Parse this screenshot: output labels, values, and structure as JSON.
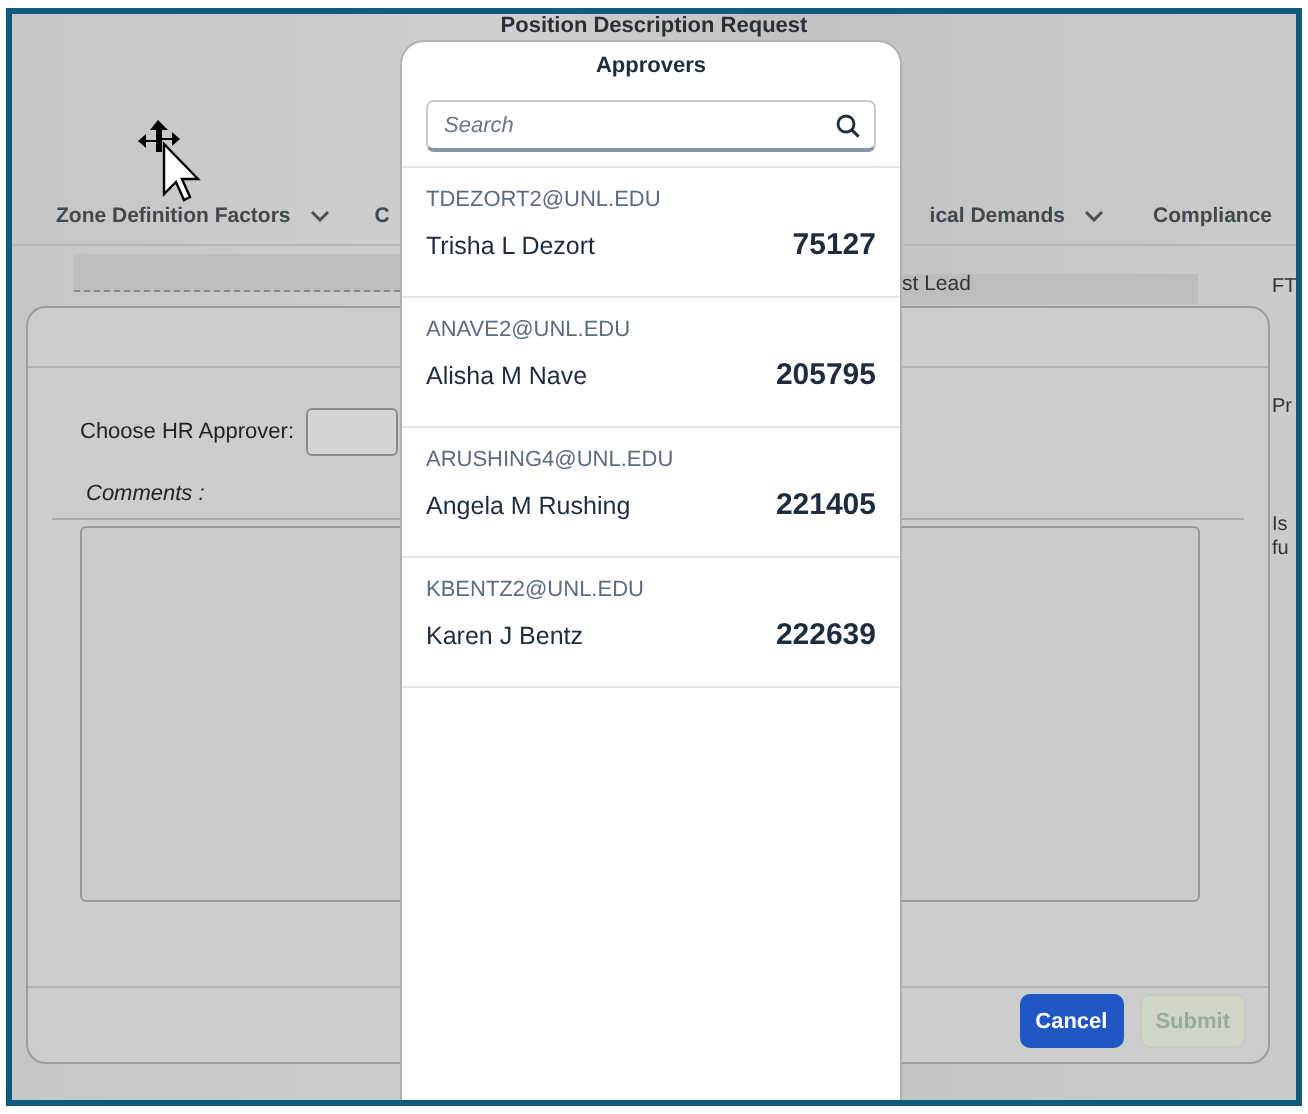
{
  "page": {
    "title": "Position Description Request",
    "tabs": [
      {
        "label": "Zone Definition Factors",
        "dropdown": true
      },
      {
        "label": "C",
        "dropdown": false
      },
      {
        "label": "ical Demands",
        "dropdown": true
      },
      {
        "label": "Compliance",
        "dropdown": false
      }
    ],
    "fragments": [
      "st Lead",
      "FT",
      "Pr",
      "Is",
      "fu"
    ]
  },
  "dialog": {
    "approver_label": "Choose HR Approver:",
    "comments_label": "Comments :",
    "buttons": [
      {
        "label": "Cancel",
        "disabled": false
      },
      {
        "label": "Submit",
        "disabled": true
      }
    ]
  },
  "popover": {
    "title": "Approvers",
    "search": {
      "placeholder": "Search"
    },
    "approvers": [
      {
        "email": "TDEZORT2@UNL.EDU",
        "name": "Trisha L Dezort",
        "number": "75127"
      },
      {
        "email": "ANAVE2@UNL.EDU",
        "name": "Alisha M Nave",
        "number": "205795"
      },
      {
        "email": "ARUSHING4@UNL.EDU",
        "name": "Angela M Rushing",
        "number": "221405"
      },
      {
        "email": "KBENTZ2@UNL.EDU",
        "name": "Karen J Bentz",
        "number": "222639"
      }
    ]
  }
}
